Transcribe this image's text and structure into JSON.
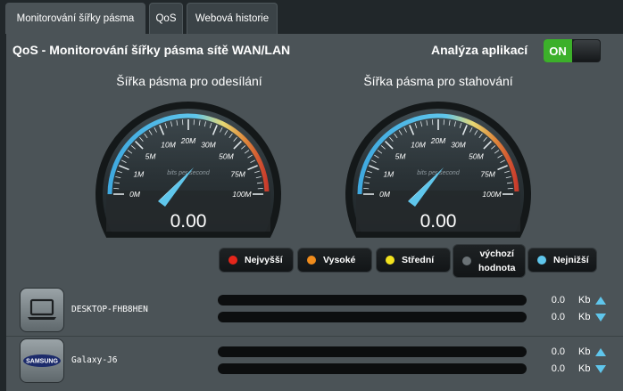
{
  "tabs": [
    {
      "label": "Monitorování šířky pásma",
      "active": true
    },
    {
      "label": "QoS",
      "active": false
    },
    {
      "label": "Webová historie",
      "active": false
    }
  ],
  "header": {
    "title": "QoS - Monitorování šířky pásma sítě WAN/LAN",
    "app_analysis_label": "Analýza aplikací",
    "toggle_label": "ON"
  },
  "gauges": [
    {
      "title": "Šířka pásma pro odesílání",
      "value": "0.00",
      "unit_caption": "bits per second",
      "ticks": [
        "0M",
        "1M",
        "5M",
        "10M",
        "20M",
        "30M",
        "50M",
        "75M",
        "100M"
      ]
    },
    {
      "title": "Šířka pásma pro stahování",
      "value": "0.00",
      "unit_caption": "bits per second",
      "ticks": [
        "0M",
        "1M",
        "5M",
        "10M",
        "20M",
        "30M",
        "50M",
        "75M",
        "100M"
      ]
    }
  ],
  "legend": [
    {
      "label": "Nejvyšší",
      "color": "#e5261b"
    },
    {
      "label": "Vysoké",
      "color": "#f08c1c"
    },
    {
      "label": "Střední",
      "color": "#f2e21e"
    },
    {
      "label": "výchozí hodnota",
      "line1": "výchozí",
      "line2": "hodnota",
      "color": "#6b7276"
    },
    {
      "label": "Nejnižší",
      "color": "#5fc6ec"
    }
  ],
  "devices": [
    {
      "name": "DESKTOP-FHB8HEN",
      "icon": "laptop-icon",
      "upload": {
        "value": "0.0",
        "unit": "Kb"
      },
      "download": {
        "value": "0.0",
        "unit": "Kb"
      }
    },
    {
      "name": "Galaxy-J6",
      "icon": "samsung-icon",
      "brand": "SAMSUNG",
      "upload": {
        "value": "0.0",
        "unit": "Kb"
      },
      "download": {
        "value": "0.0",
        "unit": "Kb"
      }
    }
  ]
}
